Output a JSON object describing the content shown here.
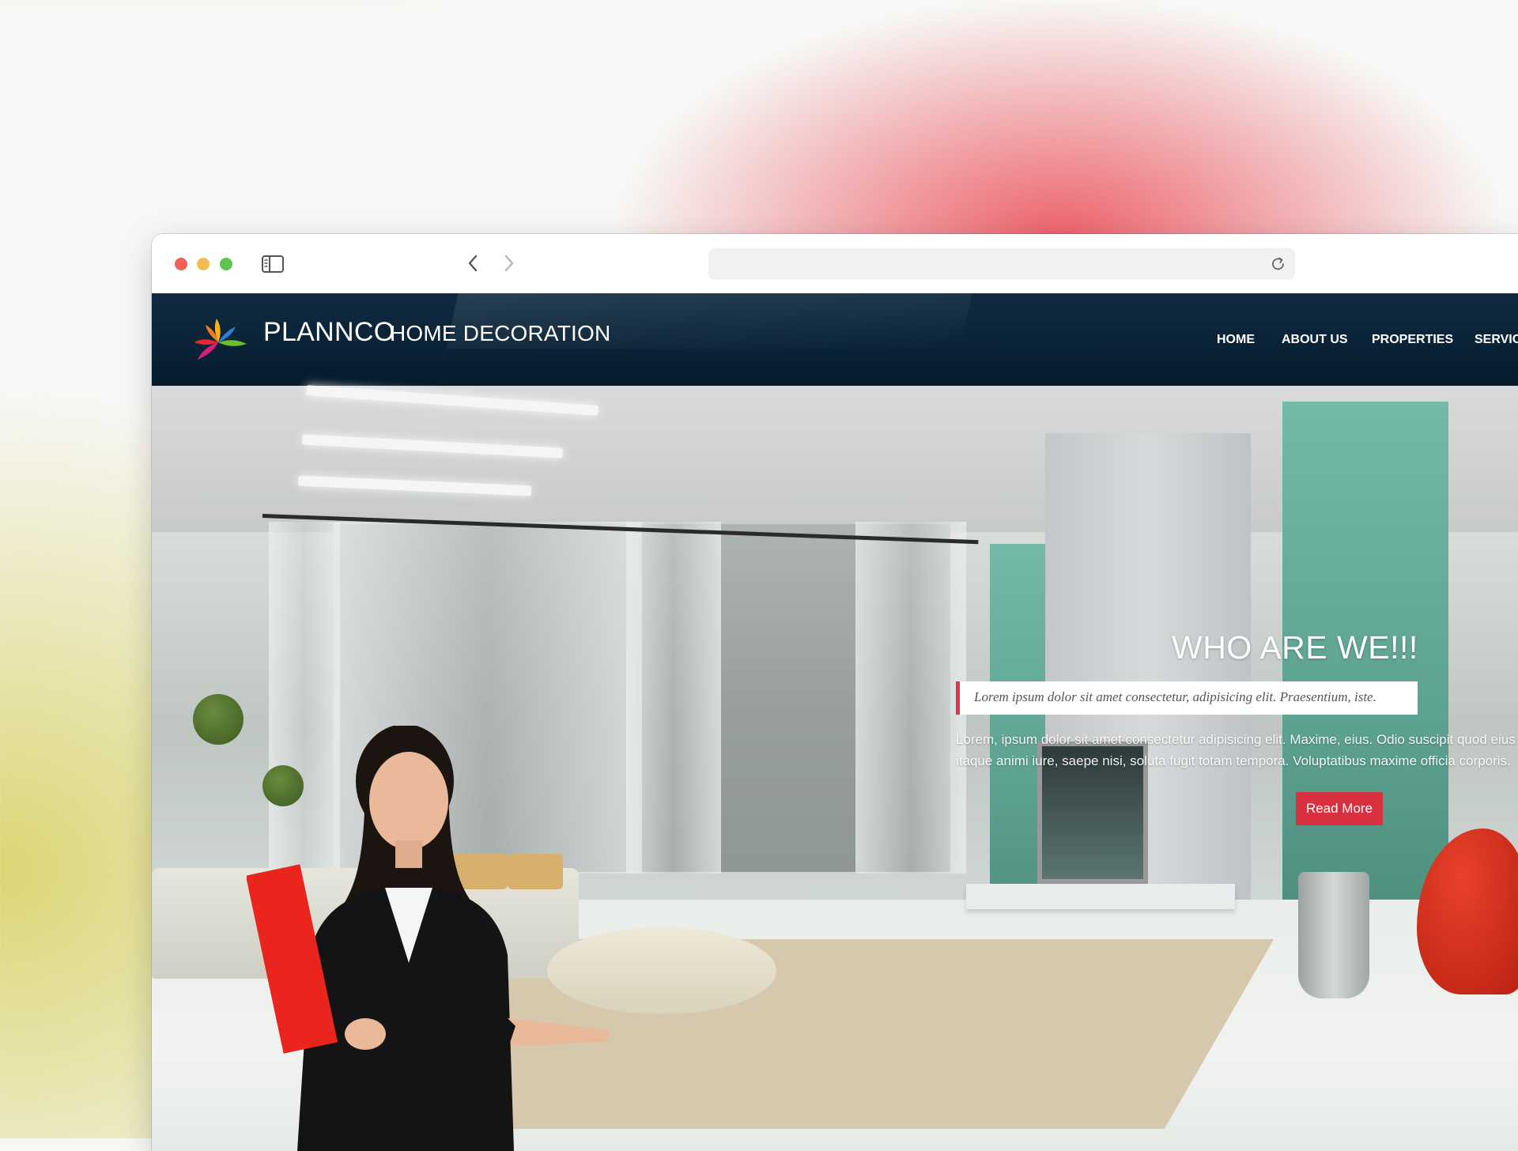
{
  "browser": {
    "url": "",
    "icons": [
      "sidebar-icon",
      "back-icon",
      "forward-icon",
      "shield-icon",
      "reload-icon"
    ]
  },
  "site": {
    "brand_name": "PLANNCO",
    "brand_tagline": "HOME DECORATION",
    "nav": [
      "HOME",
      "ABOUT US",
      "PROPERTIES",
      "SERVIC"
    ],
    "hero": {
      "title": "WHO ARE WE!!!",
      "quote": "Lorem ipsum dolor sit amet consectetur, adipisicing elit. Praesentium, iste.",
      "body_line1": "Lorem, ipsum dolor sit amet consectetur adipisicing elit. Maxime, eius. Odio suscipit quod eius rep",
      "body_line2": "itaque animi iure, saepe nisi, soluta fugit totam tempora. Voluptatibus maxime officia corporis.",
      "button": "Read More"
    }
  },
  "colors": {
    "header_bg": "#0a2236",
    "accent_red": "#d9303f",
    "quote_border": "#e0324a"
  }
}
